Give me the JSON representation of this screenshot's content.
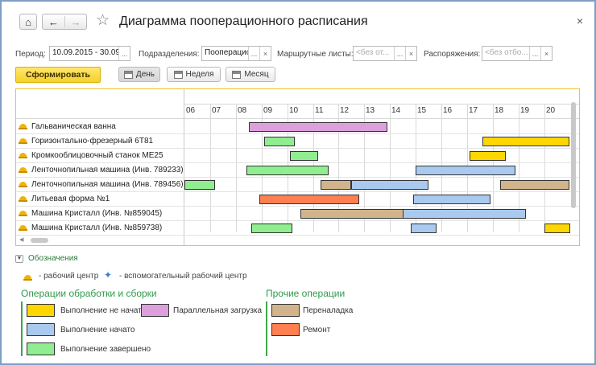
{
  "window": {
    "title": "Диаграмма пооперационного расписания",
    "close_glyph": "×",
    "home_glyph": "⌂",
    "back_glyph": "←",
    "forward_glyph": "→",
    "star_glyph": "☆"
  },
  "filters": {
    "period_label": "Период:",
    "period_value": "10.09.2015 - 30.09.",
    "division_label": "Подразделения:",
    "division_value": "Пооперацис",
    "route_sheets_label": "Маршрутные листы:",
    "route_sheets_placeholder": "<без от...",
    "orders_label": "Распоряжения:",
    "orders_placeholder": "<без отбо...",
    "select_glyph": "...",
    "clear_glyph": "×"
  },
  "toolbar": {
    "generate_label": "Сформировать",
    "day_label": "День",
    "week_label": "Неделя",
    "month_label": "Месяц",
    "active_scale": "День"
  },
  "chart_data": {
    "type": "gantt",
    "hours": [
      "06",
      "07",
      "08",
      "09",
      "10",
      "11",
      "12",
      "13",
      "14",
      "15",
      "16",
      "17",
      "18",
      "19",
      "20"
    ],
    "rows": [
      {
        "name": "Гальваническая ванна",
        "bars": [
          {
            "start": 8.5,
            "end": 13.9,
            "status": "parallel"
          }
        ]
      },
      {
        "name": "Горизонтально-фрезерный 6Т81",
        "bars": [
          {
            "start": 9.1,
            "end": 10.3,
            "status": "completed"
          },
          {
            "start": 17.6,
            "end": 21.0,
            "status": "not_started"
          }
        ]
      },
      {
        "name": "Кромкооблицовочный станок МЕ25",
        "bars": [
          {
            "start": 10.1,
            "end": 11.2,
            "status": "completed"
          },
          {
            "start": 17.1,
            "end": 18.5,
            "status": "not_started"
          }
        ]
      },
      {
        "name": "Ленточнопильная машина (Инв. 789233)",
        "bars": [
          {
            "start": 8.4,
            "end": 11.6,
            "status": "completed"
          },
          {
            "start": 15.0,
            "end": 18.9,
            "status": "started"
          }
        ]
      },
      {
        "name": "Ленточнопильная машина (Инв. 789456)",
        "bars": [
          {
            "start": 6.0,
            "end": 7.2,
            "status": "completed"
          },
          {
            "start": 11.3,
            "end": 12.5,
            "status": "setup"
          },
          {
            "start": 12.5,
            "end": 15.5,
            "status": "started"
          },
          {
            "start": 18.3,
            "end": 21.0,
            "status": "setup"
          }
        ]
      },
      {
        "name": "Литьевая форма №1",
        "bars": [
          {
            "start": 8.9,
            "end": 12.8,
            "status": "repair"
          },
          {
            "start": 14.9,
            "end": 17.9,
            "status": "started"
          }
        ]
      },
      {
        "name": "Машина Кристалл (Инв. №859045)",
        "bars": [
          {
            "start": 10.5,
            "end": 14.5,
            "status": "setup"
          },
          {
            "start": 14.5,
            "end": 19.3,
            "status": "started"
          }
        ]
      },
      {
        "name": "Машина Кристалл (Инв. №859738)",
        "bars": [
          {
            "start": 8.6,
            "end": 10.2,
            "status": "completed"
          },
          {
            "start": 14.8,
            "end": 15.8,
            "status": "started"
          },
          {
            "start": 20.0,
            "end": 21.0,
            "status": "not_started"
          }
        ]
      }
    ]
  },
  "colors": {
    "not_started": "#ffd700",
    "started": "#a9c9ef",
    "completed": "#90ee90",
    "parallel": "#dda0dd",
    "setup": "#d2b48c",
    "repair": "#ff7f50"
  },
  "legend": {
    "toggle_label": "Обозначения",
    "work_center_label": "- рабочий центр",
    "aux_center_label": "- вспомогательный рабочий центр",
    "processing_title": "Операции обработки и сборки",
    "other_title": "Прочие операции",
    "items": {
      "not_started": "Выполнение не начато",
      "started": "Выполнение начато",
      "completed": "Выполнение завершено",
      "parallel": "Параллельная загрузка",
      "setup": "Переналадка",
      "repair": "Ремонт"
    }
  }
}
